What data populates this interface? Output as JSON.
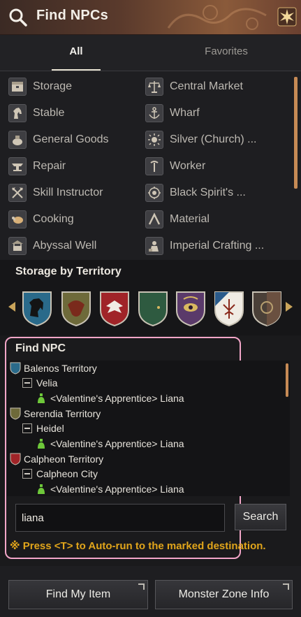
{
  "window": {
    "title": "Find NPCs"
  },
  "tabs": [
    {
      "label": "All",
      "active": true
    },
    {
      "label": "Favorites",
      "active": false
    }
  ],
  "npc_categories": {
    "left": [
      {
        "label": "Storage",
        "icon": "storage-icon"
      },
      {
        "label": "Stable",
        "icon": "horse-icon"
      },
      {
        "label": "General Goods",
        "icon": "goods-bag-icon"
      },
      {
        "label": "Repair",
        "icon": "anvil-icon"
      },
      {
        "label": "Skill Instructor",
        "icon": "crossed-axes-icon"
      },
      {
        "label": "Cooking",
        "icon": "roast-chicken-icon"
      },
      {
        "label": "Abyssal Well",
        "icon": "well-icon"
      }
    ],
    "right": [
      {
        "label": "Central Market",
        "icon": "scales-icon"
      },
      {
        "label": "Wharf",
        "icon": "anchor-icon"
      },
      {
        "label": "Silver (Church) ...",
        "icon": "church-sun-icon"
      },
      {
        "label": "Worker",
        "icon": "worker-pick-icon"
      },
      {
        "label": "Black Spirit's ...",
        "icon": "black-spirit-icon"
      },
      {
        "label": "Material",
        "icon": "material-icon"
      },
      {
        "label": "Imperial Crafting ...",
        "icon": "imperial-crafting-icon"
      }
    ]
  },
  "storage_by_territory": {
    "title": "Storage by Territory",
    "crests": [
      {
        "name": "balenos-crest",
        "color": "#2a6a8a"
      },
      {
        "name": "serendia-crest",
        "color": "#6e6a3a"
      },
      {
        "name": "calpheon-crest",
        "color": "#a02428"
      },
      {
        "name": "mediah-crest",
        "color": "#2e5a40"
      },
      {
        "name": "valencia-crest",
        "color": "#5a3a6a"
      },
      {
        "name": "kamasylvia-crest",
        "color": "#2a5a8a"
      },
      {
        "name": "drieghan-crest",
        "color": "#6a5a48"
      }
    ]
  },
  "find_npc": {
    "title": "Find NPC",
    "tree": [
      {
        "type": "territory",
        "label": "Balenos Territory"
      },
      {
        "type": "town",
        "label": "Velia"
      },
      {
        "type": "npc",
        "label": "<Valentine's Apprentice> Liana"
      },
      {
        "type": "territory",
        "label": "Serendia Territory"
      },
      {
        "type": "town",
        "label": "Heidel"
      },
      {
        "type": "npc",
        "label": "<Valentine's Apprentice> Liana"
      },
      {
        "type": "territory",
        "label": "Calpheon Territory"
      },
      {
        "type": "town",
        "label": "Calpheon City"
      },
      {
        "type": "npc",
        "label": "<Valentine's Apprentice> Liana"
      }
    ],
    "search_value": "liana",
    "search_button": "Search",
    "hint": "※ Press <T> to Auto-run to the marked destination."
  },
  "bottom_buttons": {
    "find_my_item": "Find My Item",
    "monster_zone_info": "Monster Zone Info"
  },
  "colors": {
    "accent_orange": "#e1a51b",
    "highlight_border": "#f2a6c8",
    "scrollbar": "#c68a55"
  }
}
